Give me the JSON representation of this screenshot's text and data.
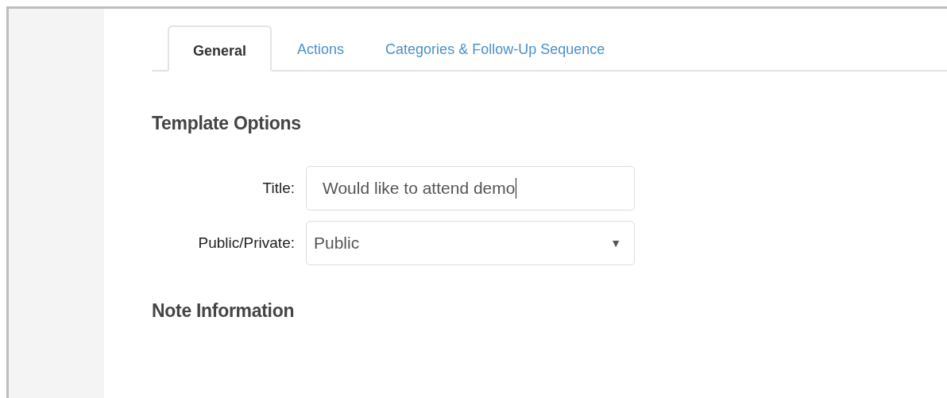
{
  "tabs": [
    {
      "label": "General",
      "selected": true
    },
    {
      "label": "Actions",
      "selected": false
    },
    {
      "label": "Categories & Follow-Up Sequence",
      "selected": false
    }
  ],
  "sections": [
    {
      "heading": "Template Options",
      "fields": [
        {
          "kind": "text",
          "label": "Title:",
          "value": "Would like to attend demo",
          "focused": true
        },
        {
          "kind": "select",
          "label": "Public/Private:",
          "value": "Public",
          "arrow": "▼"
        }
      ]
    },
    {
      "heading": "Note Information"
    }
  ]
}
